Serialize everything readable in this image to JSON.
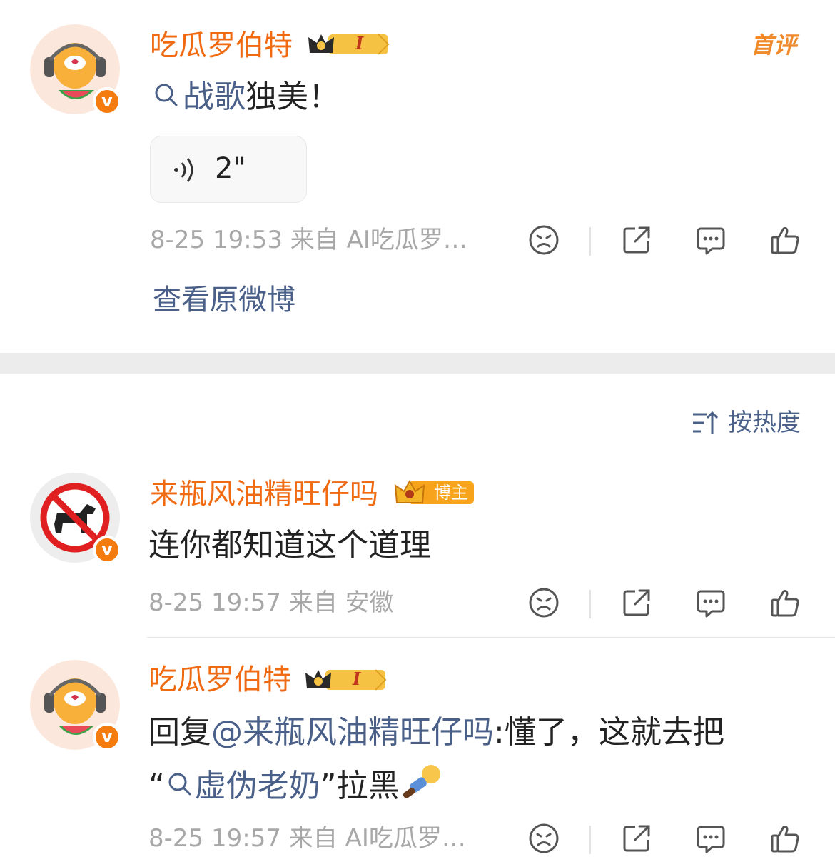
{
  "post": {
    "username": "吃瓜罗伯特",
    "level_badge": "I",
    "first_comment_badge": "首评",
    "content_link": "战歌",
    "content_text": "独美！",
    "voice_duration": "2\"",
    "meta": "8-25 19:53  来自 AI吃瓜罗…",
    "view_original": "查看原微博"
  },
  "sort": {
    "label": "按热度"
  },
  "comments": [
    {
      "username": "来瓶风油精旺仔吗",
      "badge": "博主",
      "content": "连你都知道这个道理",
      "meta": "8-25 19:57  来自 安徽"
    },
    {
      "username": "吃瓜罗伯特",
      "level_badge": "I",
      "reply_prefix": "回复",
      "mention": "@来瓶风油精旺仔吗",
      "reply_text": ":懂了，这就去把",
      "quote_open": "“",
      "topic_link": "虚伪老奶",
      "quote_close": "”",
      "tail_text": "拉黑",
      "meta": "8-25 19:57  来自 AI吃瓜罗…"
    }
  ],
  "colors": {
    "username": "#f06a12",
    "link": "#4a6089",
    "meta": "#a8a8a8",
    "vbadge": "#f47b0d",
    "band": "#ececec"
  },
  "icons": [
    "sad-face-icon",
    "share-icon",
    "comment-icon",
    "like-icon",
    "search-icon",
    "sound-wave-icon",
    "crown-icon",
    "sort-icon",
    "lying-emoji-icon"
  ]
}
